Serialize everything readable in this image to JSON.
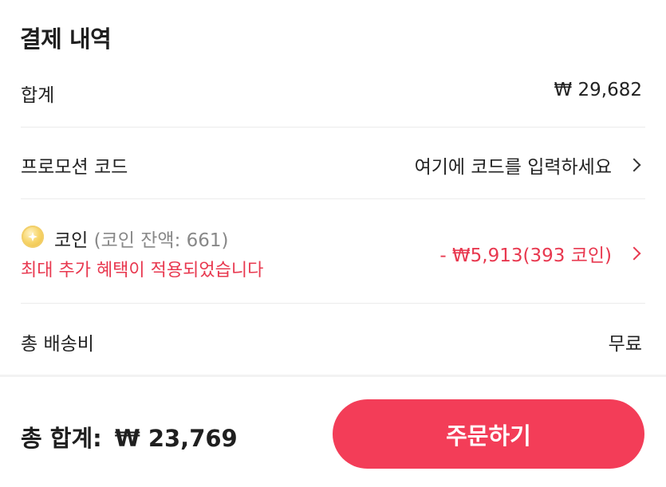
{
  "section_title": "결제 내역",
  "subtotal": {
    "label": "합계",
    "value": "₩ 29,682"
  },
  "promo": {
    "label": "프로모션 코드",
    "placeholder": "여기에 코드를 입력하세요"
  },
  "coin": {
    "label": "코인",
    "balance": "(코인 잔액: 661)",
    "notice": "최대 추가 혜택이 적용되었습니다",
    "discount": "- ₩5,913(393 코인)"
  },
  "shipping": {
    "label": "총 배송비",
    "value": "무료"
  },
  "footer": {
    "total_label": "총 합계:",
    "total_amount": "₩ 23,769",
    "order_button": "주문하기"
  },
  "colors": {
    "accent": "#f33d58",
    "discount_text": "#e8384f"
  },
  "icons": {
    "coin": "coin-icon",
    "chevron": "chevron-right-icon"
  }
}
